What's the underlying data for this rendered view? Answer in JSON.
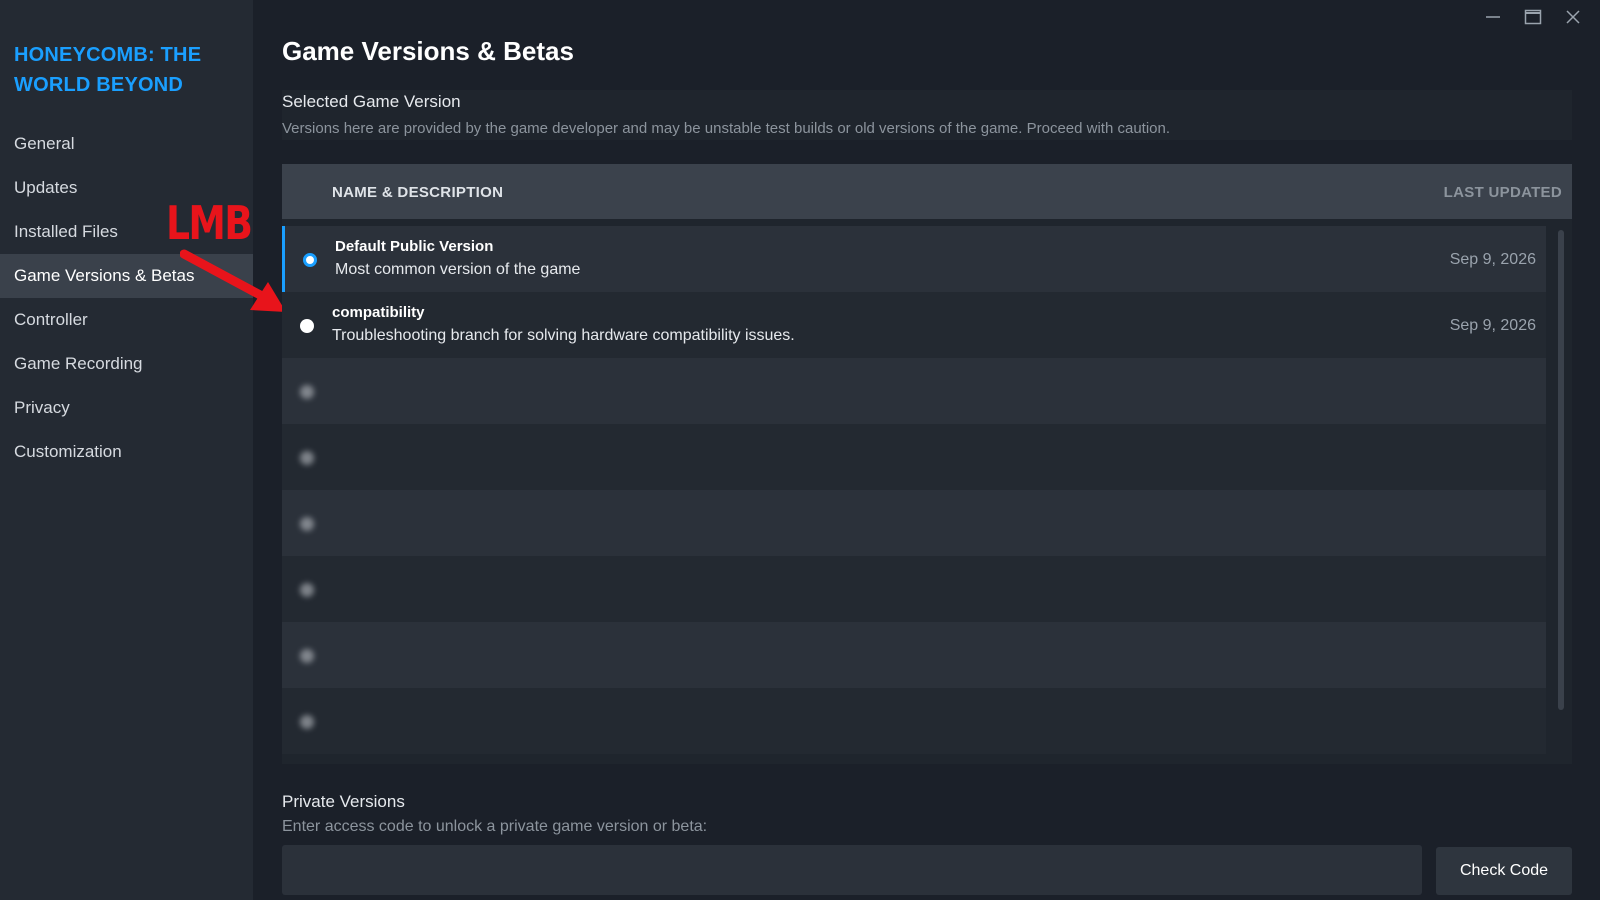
{
  "window": {
    "minimize_icon": "minimize-icon",
    "maximize_icon": "maximize-icon",
    "close_icon": "close-icon"
  },
  "sidebar": {
    "game_title": "HONEYCOMB: THE WORLD BEYOND",
    "items": [
      {
        "label": "General",
        "active": false
      },
      {
        "label": "Updates",
        "active": false
      },
      {
        "label": "Installed Files",
        "active": false
      },
      {
        "label": "Game Versions & Betas",
        "active": true
      },
      {
        "label": "Controller",
        "active": false
      },
      {
        "label": "Game Recording",
        "active": false
      },
      {
        "label": "Privacy",
        "active": false
      },
      {
        "label": "Customization",
        "active": false
      }
    ]
  },
  "annotation": {
    "label": "LMB",
    "color": "#e8141b"
  },
  "main": {
    "title": "Game Versions & Betas",
    "selected_version": {
      "title": "Selected Game Version",
      "description": "Versions here are provided by the game developer and may be unstable test builds or old versions of the game. Proceed with caution."
    },
    "table": {
      "headers": {
        "name": "NAME & DESCRIPTION",
        "updated": "LAST UPDATED"
      },
      "rows": [
        {
          "name": "Default Public Version",
          "description": "Most common version of the game",
          "date": "Sep 9, 2026",
          "selected": true,
          "blurred": false
        },
        {
          "name": "compatibility",
          "description": "Troubleshooting branch for solving hardware compatibility issues.",
          "date": "Sep 9, 2026",
          "selected": false,
          "blurred": false
        },
        {
          "name": "",
          "description": "",
          "date": "",
          "selected": false,
          "blurred": true
        },
        {
          "name": "",
          "description": "",
          "date": "",
          "selected": false,
          "blurred": true
        },
        {
          "name": "",
          "description": "",
          "date": "",
          "selected": false,
          "blurred": true
        },
        {
          "name": "",
          "description": "",
          "date": "",
          "selected": false,
          "blurred": true
        },
        {
          "name": "",
          "description": "",
          "date": "",
          "selected": false,
          "blurred": true
        },
        {
          "name": "",
          "description": "",
          "date": "",
          "selected": false,
          "blurred": true
        }
      ]
    },
    "private_versions": {
      "title": "Private Versions",
      "description": "Enter access code to unlock a private game version or beta:",
      "input_value": "",
      "button_label": "Check Code"
    }
  },
  "colors": {
    "accent": "#1a9fff",
    "background": "#1b2029",
    "sidebar": "#242a33"
  }
}
